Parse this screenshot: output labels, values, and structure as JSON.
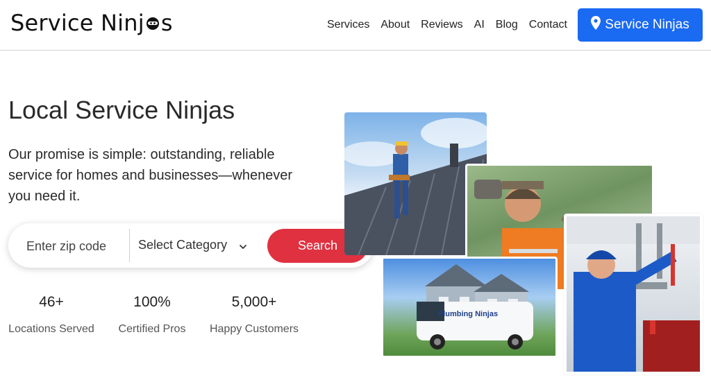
{
  "header": {
    "logo_text_start": "Service Ninj",
    "logo_text_end": "s",
    "nav": [
      "Services",
      "About",
      "Reviews",
      "AI",
      "Blog",
      "Contact"
    ],
    "cta_label": "Service Ninjas",
    "colors": {
      "cta": "#1a6af2"
    }
  },
  "hero": {
    "title": "Local Service Ninjas",
    "description": "Our promise is simple: outstanding, reliable service for homes and businesses—whenever you need it."
  },
  "search": {
    "zip_placeholder": "Enter zip code",
    "category_selected": "Select Category",
    "button_label": "Search",
    "colors": {
      "button": "#e03140"
    }
  },
  "stats": [
    {
      "value": "46+",
      "label": "Locations Served"
    },
    {
      "value": "100%",
      "label": "Certified Pros"
    },
    {
      "value": "5,000+",
      "label": "Happy Customers"
    }
  ],
  "photos": {
    "van_text": "Plumbing Ninjas"
  }
}
